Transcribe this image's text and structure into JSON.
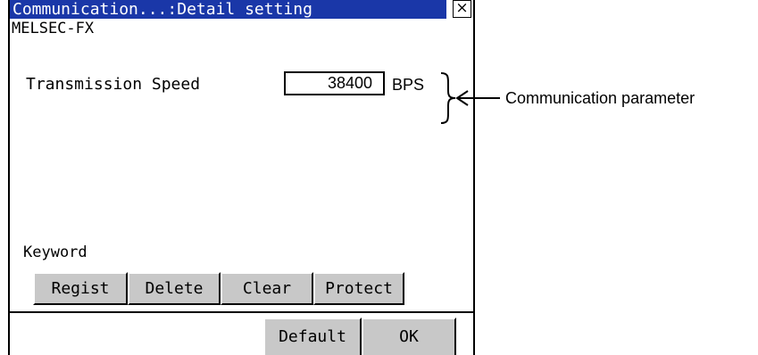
{
  "window": {
    "title": "Communication...:Detail setting",
    "close_label": "×",
    "subtitle": "MELSEC-FX"
  },
  "parameters": [
    {
      "label": "Transmission Speed",
      "value": "38400",
      "unit": "BPS"
    }
  ],
  "keyword": {
    "label": "Keyword",
    "buttons": [
      "Regist",
      "Delete",
      "Clear",
      "Protect"
    ]
  },
  "footer": {
    "default_label": "Default",
    "ok_label": "OK"
  },
  "annotation": {
    "text": "Communication parameter"
  },
  "colors": {
    "titlebar": "#1a37a8",
    "button_face": "#c8c8c8"
  }
}
